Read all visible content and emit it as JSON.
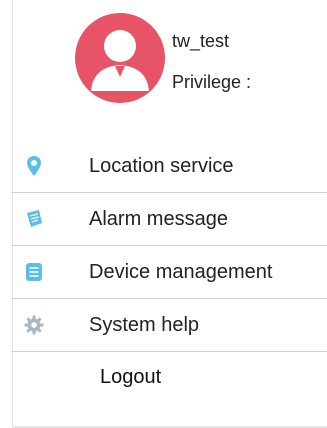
{
  "profile": {
    "username": "tw_test",
    "privilege_label": "Privilege :",
    "avatar_color": "#e85467"
  },
  "menu": {
    "items": [
      {
        "label": "Location service",
        "icon": "location-pin-icon",
        "icon_color": "#5bbde8"
      },
      {
        "label": "Alarm message",
        "icon": "alarm-message-icon",
        "icon_color": "#5bbde8"
      },
      {
        "label": "Device management",
        "icon": "document-list-icon",
        "icon_color": "#5bbde8"
      },
      {
        "label": "System help",
        "icon": "gear-icon",
        "icon_color": "#a9b7c4"
      }
    ]
  },
  "logout": {
    "label": "Logout"
  }
}
